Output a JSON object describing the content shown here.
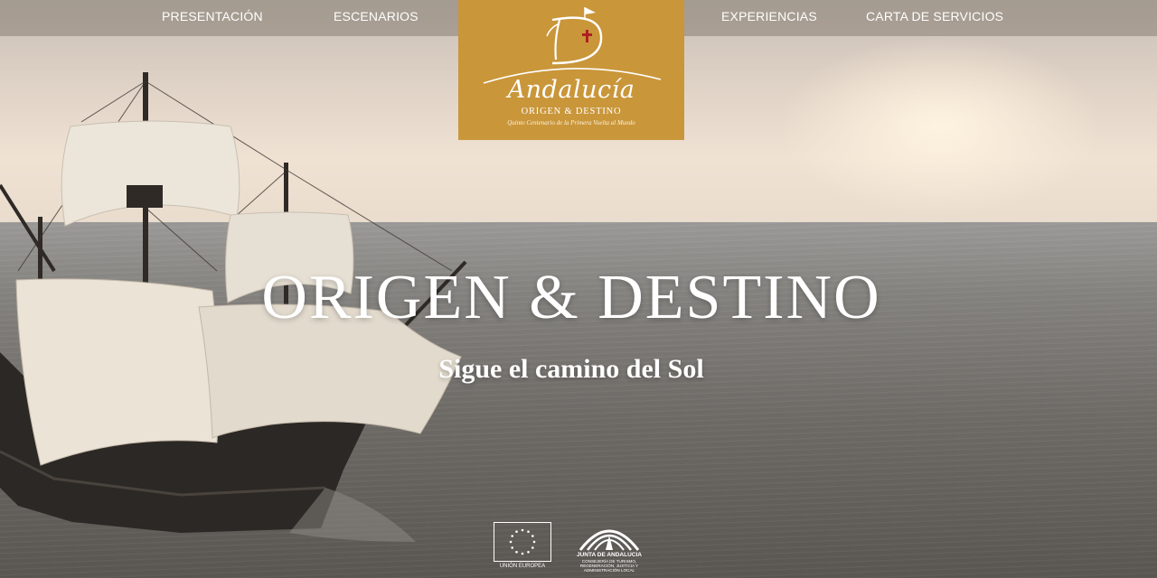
{
  "nav": {
    "items": [
      {
        "label": "PRESENTACIÓN"
      },
      {
        "label": "ESCENARIOS"
      },
      {
        "label": "EXPERIENCIAS"
      },
      {
        "label": "CARTA DE SERVICIOS"
      }
    ]
  },
  "logo": {
    "brand": "Andalucía",
    "subtitle": "ORIGEN & DESTINO",
    "tagline": "Quinto Centenario de la Primera Vuelta al Mundo",
    "background_color": "#c9963a"
  },
  "hero": {
    "title": "ORIGEN & DESTINO",
    "subtitle": "Sigue el camino del Sol"
  },
  "footer": {
    "eu_label": "UNIÓN EUROPEA",
    "junta_label": "JUNTA DE ANDALUCIA",
    "junta_department": "CONSEJERÍA DE TURISMO, REGENERACIÓN, JUSTICIA Y ADMINISTRACIÓN LOCAL"
  },
  "icons": [
    "sun-cross-emblem-icon",
    "eu-flag-icon",
    "junta-arch-icon"
  ]
}
